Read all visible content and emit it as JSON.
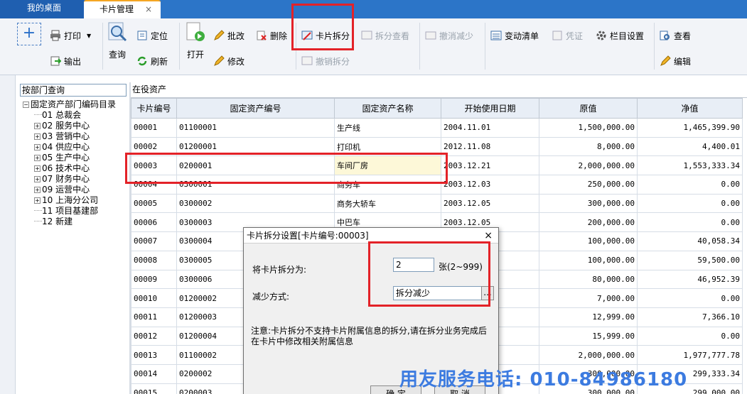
{
  "tabs": [
    {
      "label": "我的桌面"
    },
    {
      "label": "卡片管理",
      "close": "×"
    }
  ],
  "toolbar": {
    "add": "+",
    "print": "打印",
    "export": "输出",
    "query": "查询",
    "locate": "定位",
    "refresh": "刷新",
    "open": "打开",
    "batch_edit": "批改",
    "edit": "修改",
    "delete": "删除",
    "card_split": "卡片拆分",
    "split_view": "拆分查看",
    "undo_split": "撤销拆分",
    "undo_reduce": "撤消减少",
    "change_list": "变动清单",
    "voucher": "凭证",
    "column_settings": "栏目设置",
    "view": "查看",
    "edit2": "编辑"
  },
  "left": {
    "dropdown": "按部门查询",
    "tree": [
      {
        "level": 0,
        "toggle": "−",
        "label": "固定资产部门编码目录"
      },
      {
        "level": 1,
        "toggle": "",
        "label": "01 总裁会"
      },
      {
        "level": 1,
        "toggle": "+",
        "label": "02 服务中心"
      },
      {
        "level": 1,
        "toggle": "+",
        "label": "03 营销中心"
      },
      {
        "level": 1,
        "toggle": "+",
        "label": "04 供应中心"
      },
      {
        "level": 1,
        "toggle": "+",
        "label": "05 生产中心"
      },
      {
        "level": 1,
        "toggle": "+",
        "label": "06 技术中心"
      },
      {
        "level": 1,
        "toggle": "+",
        "label": "07 财务中心"
      },
      {
        "level": 1,
        "toggle": "+",
        "label": "09 运营中心"
      },
      {
        "level": 1,
        "toggle": "+",
        "label": "10 上海分公司"
      },
      {
        "level": 1,
        "toggle": "",
        "label": "11 项目基建部"
      },
      {
        "level": 1,
        "toggle": "",
        "label": "12 新建"
      }
    ]
  },
  "grid": {
    "title": "在役资产",
    "columns": [
      "卡片编号",
      "固定资产编号",
      "固定资产名称",
      "开始使用日期",
      "原值",
      "净值"
    ],
    "rows": [
      [
        "00001",
        "01100001",
        "生产线",
        "2004.11.01",
        "1,500,000.00",
        "1,465,399.90"
      ],
      [
        "00002",
        "01200001",
        "打印机",
        "2012.11.08",
        "8,000.00",
        "4,400.01"
      ],
      [
        "00003",
        "0200001",
        "车间厂房",
        "2003.12.21",
        "2,000,000.00",
        "1,553,333.34"
      ],
      [
        "00004",
        "0300001",
        "商务车",
        "2003.12.03",
        "250,000.00",
        "0.00"
      ],
      [
        "00005",
        "0300002",
        "商务大轿车",
        "2003.12.05",
        "300,000.00",
        "0.00"
      ],
      [
        "00006",
        "0300003",
        "中巴车",
        "2003.12.05",
        "200,000.00",
        "0.00"
      ],
      [
        "00007",
        "0300004",
        "",
        "",
        "100,000.00",
        "40,058.34"
      ],
      [
        "00008",
        "0300005",
        "",
        "",
        "100,000.00",
        "59,500.00"
      ],
      [
        "00009",
        "0300006",
        "",
        "",
        "80,000.00",
        "46,952.39"
      ],
      [
        "00010",
        "01200002",
        "",
        "",
        "7,000.00",
        "0.00"
      ],
      [
        "00011",
        "01200003",
        "",
        "",
        "12,999.00",
        "7,366.10"
      ],
      [
        "00012",
        "01200004",
        "",
        "",
        "15,999.00",
        "0.00"
      ],
      [
        "00013",
        "01100002",
        "",
        "",
        "2,000,000.00",
        "1,977,777.78"
      ],
      [
        "00014",
        "0200002",
        "",
        "",
        "300,000.00",
        "299,333.34"
      ],
      [
        "00015",
        "0200003",
        "",
        "",
        "300,000.00",
        "299,000.00"
      ]
    ]
  },
  "dialog": {
    "title": "卡片拆分设置[卡片编号:00003]",
    "close": "×",
    "split_label": "将卡片拆分为:",
    "split_value": "2",
    "split_unit": "张(2~999)",
    "reduce_label": "减少方式:",
    "reduce_value": "拆分减少",
    "reduce_btn": "...",
    "note": "注意:卡片拆分不支持卡片附属信息的拆分,请在拆分业务完成后在卡片中修改相关附属信息",
    "ok": "确 定",
    "cancel": "取 消"
  },
  "watermark": "用友服务电话: 010-84986180",
  "colors": {
    "highlight": "#e32228",
    "accent": "#2c75c8",
    "phone": "#3c7be0"
  }
}
